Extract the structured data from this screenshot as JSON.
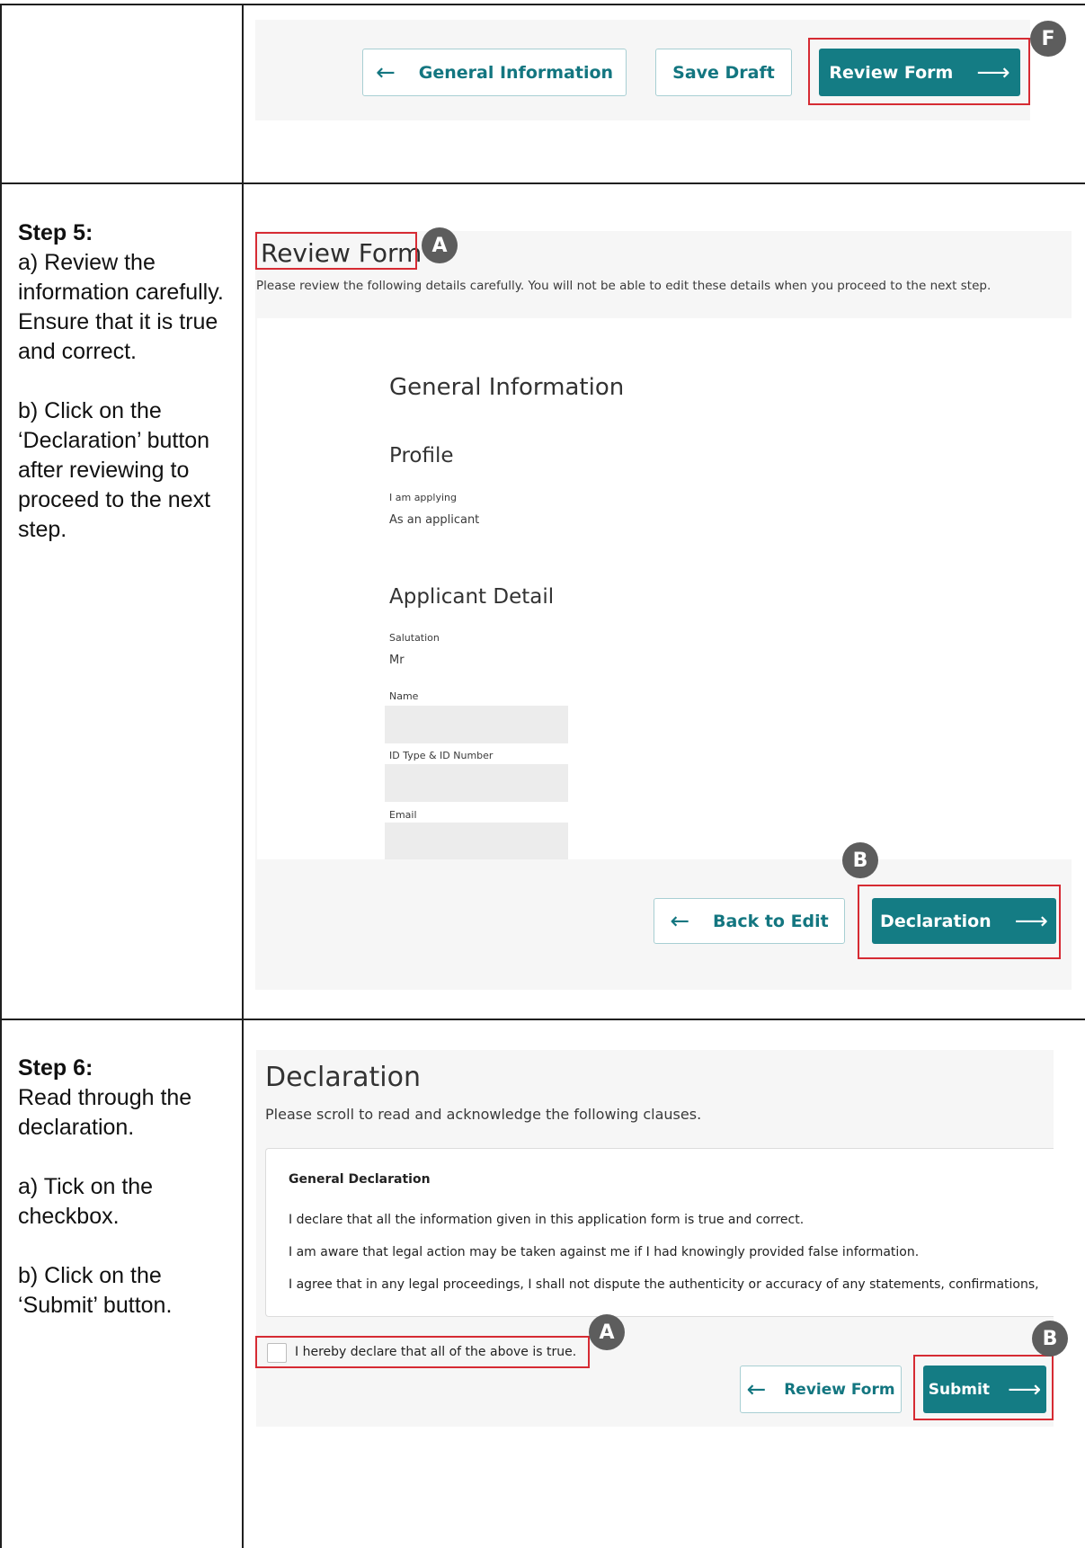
{
  "step5": {
    "title": "Step 5:",
    "para_a": "a) Review the information carefully. Ensure that it is true and correct.",
    "para_b": "b) Click on the ‘Declaration’ button after reviewing to proceed to the next step."
  },
  "step6": {
    "title": "Step 6:",
    "intro": "Read through the declaration.",
    "para_a": "a) Tick on the checkbox.",
    "para_b": "b) Click on the ‘Submit’ button."
  },
  "top_buttons": {
    "general_information": "General Information",
    "save_draft": "Save Draft",
    "review_form": "Review Form",
    "badge": "F"
  },
  "review": {
    "title": "Review Form",
    "badge_a": "A",
    "subtitle": "Please review the following details carefully. You will not be able to edit these details when you proceed to the next step.",
    "section_general": "General Information",
    "section_profile": "Profile",
    "applying_label": "I am applying",
    "applying_value": "As an applicant",
    "section_applicant": "Applicant Detail",
    "salutation_label": "Salutation",
    "salutation_value": "Mr",
    "name_label": "Name",
    "id_label": "ID Type & ID Number",
    "email_label": "Email",
    "badge_b": "B",
    "back_to_edit": "Back to Edit",
    "declaration_button": "Declaration"
  },
  "declaration": {
    "title": "Declaration",
    "subtitle": "Please scroll to read and acknowledge the following clauses.",
    "box_heading": "General Declaration",
    "clauses": [
      "I declare that all the information given in this application form is true and correct.",
      "I am aware that legal action may be taken against me if I had knowingly provided false information.",
      "I agree that in any legal proceedings, I shall not dispute the authenticity or accuracy of any statements, confirmations,"
    ],
    "checkbox_label": "I hereby declare that all of the above is true.",
    "badge_a": "A",
    "badge_b": "B",
    "review_form_button": "Review Form",
    "submit_button": "Submit"
  },
  "icons": {
    "arrow_left": "←",
    "arrow_right": "⟶"
  },
  "colors": {
    "primary_button": "#147c84",
    "highlight": "#d62b33",
    "badge": "#5d5d5d"
  }
}
